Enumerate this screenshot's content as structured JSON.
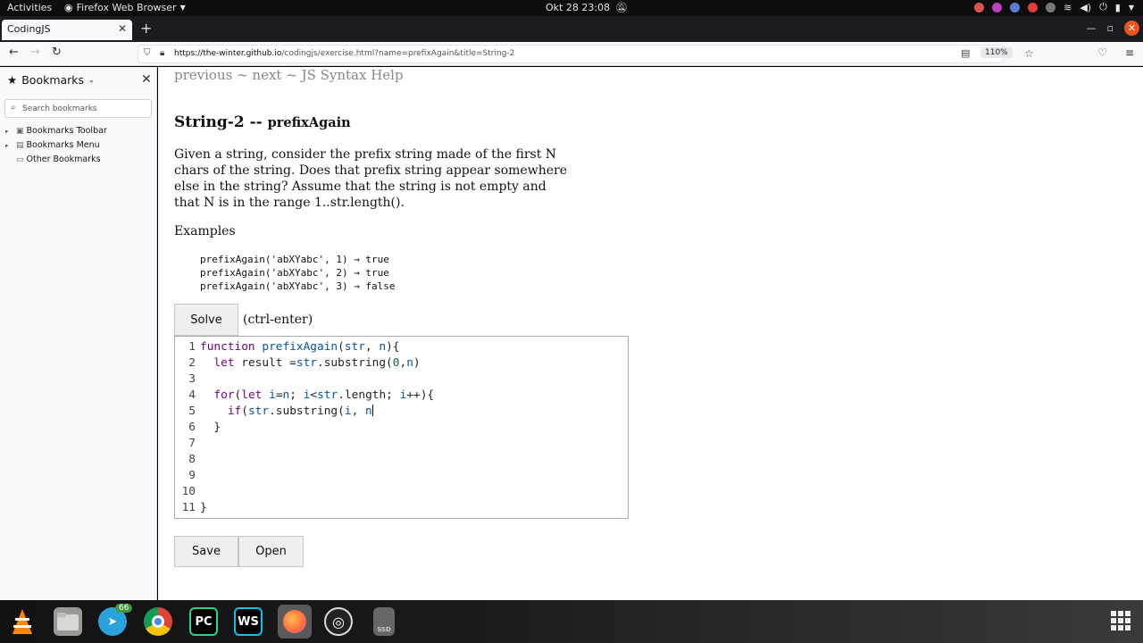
{
  "topbar": {
    "activities": "Activities",
    "app_name": "Firefox Web Browser",
    "clock": "Okt 28  23:08"
  },
  "browser": {
    "tab_title": "CodingJS",
    "url_host": "https://the-winter.github.io",
    "url_path": "/codingjs/exercise.html?name=prefixAgain&title=String-2",
    "zoom": "110%"
  },
  "sidebar": {
    "title": "Bookmarks",
    "search_placeholder": "Search bookmarks",
    "items": [
      {
        "label": "Bookmarks Toolbar"
      },
      {
        "label": "Bookmarks Menu"
      },
      {
        "label": "Other Bookmarks"
      }
    ]
  },
  "page": {
    "nav_previous": "previous",
    "nav_sep1": " ~ ",
    "nav_next": "next",
    "nav_sep2": " ~ ",
    "nav_help": "JS Syntax Help",
    "title_main": "String-2 -- ",
    "title_sub": "prefixAgain",
    "description": "Given a string, consider the prefix string made of the first N chars of the string. Does that prefix string appear somewhere else in the string? Assume that the string is not empty and that N is in the range 1..str.length().",
    "examples_heading": "Examples",
    "examples": [
      "prefixAgain('abXYabc', 1) → true",
      "prefixAgain('abXYabc', 2) → true",
      "prefixAgain('abXYabc', 3) → false"
    ],
    "solve_label": "Solve",
    "solve_hint": "(ctrl-enter)",
    "save_label": "Save",
    "open_label": "Open"
  },
  "editor": {
    "line_numbers": [
      "1",
      "2",
      "3",
      "4",
      "5",
      "6",
      "7",
      "8",
      "9",
      "10",
      "11"
    ]
  },
  "taskbar": {
    "telegram_badge": "66",
    "pycharm_label": "PC",
    "webstorm_label": "WS",
    "ssd_label": "SSD"
  },
  "colors": {
    "accent": "#e95420",
    "keyword": "#770088",
    "variable": "#0055aa",
    "number": "#116644"
  }
}
